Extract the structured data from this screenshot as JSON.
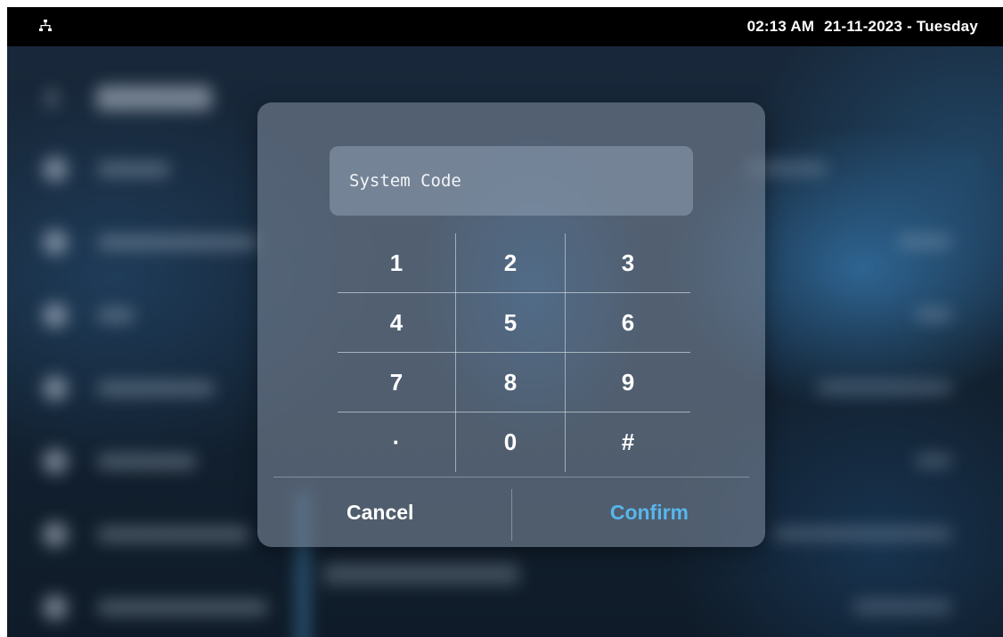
{
  "status_bar": {
    "network_icon": "network-tree-icon",
    "time": "02:13 AM",
    "date": "21-11-2023 - Tuesday"
  },
  "dialog": {
    "code_field": {
      "value": "System Code"
    },
    "keypad": {
      "keys": [
        "1",
        "2",
        "3",
        "4",
        "5",
        "6",
        "7",
        "8",
        "9",
        "·",
        "0",
        "#"
      ]
    },
    "cancel_label": "Cancel",
    "confirm_label": "Confirm",
    "colors": {
      "confirm_accent": "#58b6ec",
      "dialog_panel": "#7a8596"
    }
  }
}
